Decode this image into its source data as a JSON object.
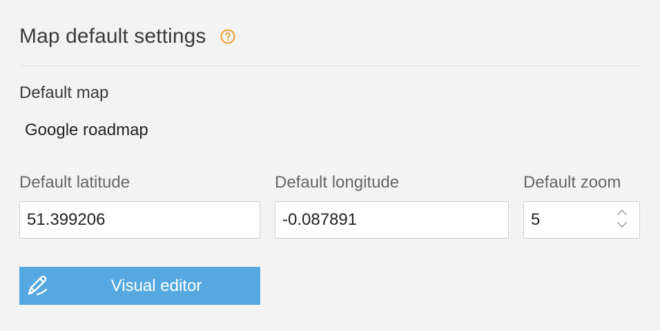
{
  "header": {
    "title": "Map default settings",
    "help_icon": "help-circle-icon",
    "accent_color": "#e8961e"
  },
  "default_map": {
    "label": "Default map",
    "value": "Google roadmap"
  },
  "fields": {
    "latitude": {
      "label": "Default latitude",
      "value": "51.399206"
    },
    "longitude": {
      "label": "Default longitude",
      "value": "-0.087891"
    },
    "zoom": {
      "label": "Default zoom",
      "value": "5"
    }
  },
  "actions": {
    "visual_editor_label": "Visual editor",
    "visual_editor_icon": "pencil-icon",
    "button_color": "#55a9e0"
  }
}
